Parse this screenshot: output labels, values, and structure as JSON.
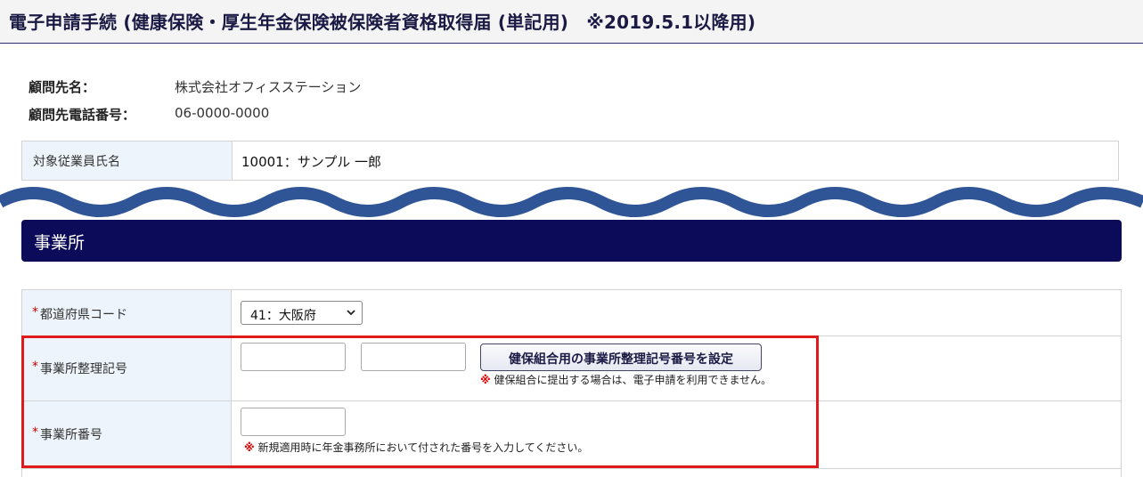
{
  "header": {
    "title": "電子申請手続 (健康保険・厚生年金保険被保険者資格取得届 (単記用)　※2019.5.1以降用)"
  },
  "client": {
    "name_label": "顧問先名：",
    "name_value": "株式会社オフィスステーション",
    "phone_label": "顧問先電話番号：",
    "phone_value": "06-0000-0000"
  },
  "employee": {
    "label": "対象従業員氏名",
    "value": "10001：サンプル 一郎"
  },
  "section": {
    "title": "事業所"
  },
  "form": {
    "required_mark": "*",
    "prefecture": {
      "label": "都道府県コード",
      "selected": "41：大阪府"
    },
    "office_code": {
      "label": "事業所整理記号",
      "value1": "",
      "value2": "",
      "button_label": "健保組合用の事業所整理記号番号を設定",
      "note_mark": "※",
      "note_text": "健保組合に提出する場合は、電子申請を利用できません。"
    },
    "office_number": {
      "label": "事業所番号",
      "value": "",
      "note_mark": "※",
      "note_text": "新規適用時に年金事務所において付された番号を入力してください。"
    }
  },
  "colors": {
    "header_border": "#2c2c6a",
    "section_bar": "#0b0b5a",
    "wave": "#2f5597",
    "highlight": "#e0191b",
    "label_bg": "#eef4fb"
  }
}
